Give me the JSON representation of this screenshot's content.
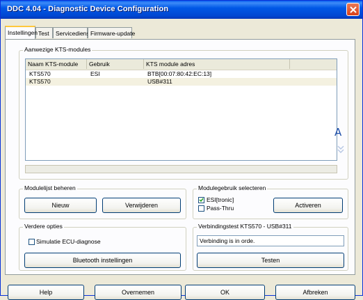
{
  "window": {
    "title": "DDC 4.04 - Diagnostic Device Configuration"
  },
  "tabs": [
    "Instellingen",
    "Test",
    "Servicedienst",
    "Firmware-update"
  ],
  "modules": {
    "group_label": "Aanwezige KTS-modules",
    "columns": [
      "Naam KTS-module",
      "Gebruik",
      "KTS module adres"
    ],
    "rows": [
      {
        "name": "KTS570",
        "usage": "ESI",
        "address": "BTB[00:07:80:42:EC:13]"
      },
      {
        "name": "KTS570",
        "usage": "",
        "address": "USB#311"
      }
    ],
    "scroll_up_glyph": "A"
  },
  "modulelist": {
    "group_label": "Modulelijst beheren",
    "new_label": "Nieuw",
    "delete_label": "Verwijderen"
  },
  "moduleuse": {
    "group_label": "Modulegebruik selecteren",
    "esi_label": "ESI[tronic]",
    "passthru_label": "Pass-Thru",
    "activate_label": "Activeren"
  },
  "options": {
    "group_label": "Verdere opties",
    "simulate_label": "Simulatie ECU-diagnose",
    "bluetooth_label": "Bluetooth instellingen"
  },
  "conntest": {
    "group_label": "Verbindingstest KTS570 - USB#311",
    "status_value": "Verbinding is in orde.",
    "test_label": "Testen"
  },
  "footer": {
    "help_label": "Help",
    "apply_label": "Overnemen",
    "ok_label": "OK",
    "cancel_label": "Afbreken"
  }
}
